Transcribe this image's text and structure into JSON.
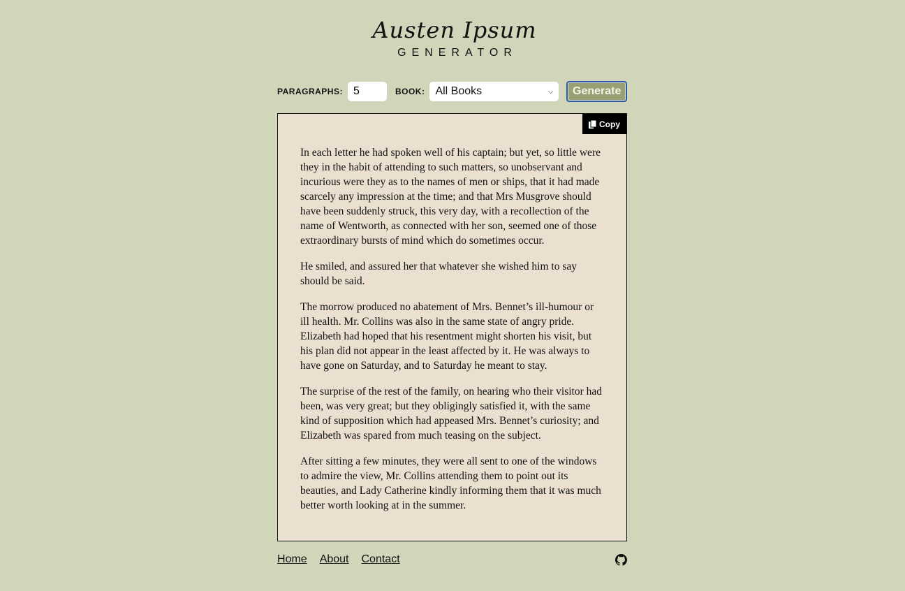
{
  "logo": {
    "title": "Austen Ipsum",
    "subtitle": "GENERATOR"
  },
  "controls": {
    "paragraphs_label": "PARAGRAPHS:",
    "paragraphs_value": "5",
    "book_label": "BOOK:",
    "book_selected": "All Books",
    "generate_label": "Generate"
  },
  "output": {
    "copy_label": "Copy",
    "paragraphs": [
      "In each letter he had spoken well of his captain; but yet, so little were they in the habit of attending to such matters, so unobservant and incurious were they as to the names of men or ships, that it had made scarcely any impression at the time; and that Mrs Musgrove should have been suddenly struck, this very day, with a recollection of the name of Wentworth, as connected with her son, seemed one of those extraordinary bursts of mind which do sometimes occur.",
      "He smiled, and assured her that whatever she wished him to say should be said.",
      "The morrow produced no abatement of Mrs. Bennet’s ill-humour or ill health. Mr. Collins was also in the same state of angry pride. Elizabeth had hoped that his resentment might shorten his visit, but his plan did not appear in the least affected by it. He was always to have gone on Saturday, and to Saturday he meant to stay.",
      "The surprise of the rest of the family, on hearing who their visitor had been, was very great; but they obligingly satisfied it, with the same kind of supposition which had appeased Mrs. Bennet’s curiosity; and Elizabeth was spared from much teasing on the subject.",
      "After sitting a few minutes, they were all sent to one of the windows to admire the view, Mr. Collins attending them to point out its beauties, and Lady Catherine kindly informing them that it was much better worth looking at in the summer."
    ]
  },
  "footer": {
    "links": [
      "Home",
      "About",
      "Contact"
    ],
    "icon": "github-icon"
  },
  "colors": {
    "background": "#d1d5b9",
    "text_box": "#ebe0d0",
    "button": "#9aa073",
    "button_focus": "#2a5aa8"
  }
}
